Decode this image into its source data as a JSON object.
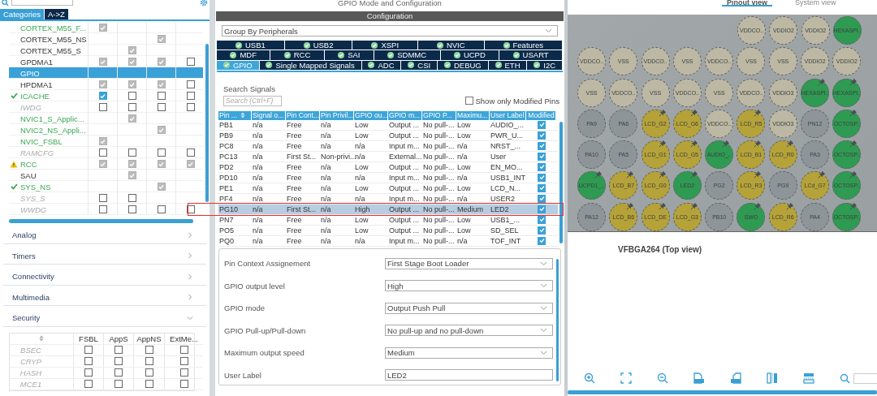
{
  "left": {
    "tabs": [
      {
        "label": "Categories",
        "selected": true
      },
      {
        "label": "A->Z",
        "selected": false
      }
    ],
    "rows": [
      {
        "name": "CORTEX_M55_F...",
        "kind": "configured",
        "ok": false,
        "warning": false,
        "selected": false,
        "cells": [
          {
            "kind": "box",
            "checked": true,
            "disabled": true
          },
          {
            "kind": "blank"
          },
          {
            "kind": "blank"
          },
          {
            "kind": "blank"
          }
        ]
      },
      {
        "name": "CORTEX_M55_NS",
        "kind": "plain",
        "ok": false,
        "warning": false,
        "selected": false,
        "cells": [
          {
            "kind": "blank"
          },
          {
            "kind": "blank"
          },
          {
            "kind": "box",
            "checked": true,
            "disabled": true
          },
          {
            "kind": "blank"
          }
        ]
      },
      {
        "name": "CORTEX_M55_S",
        "kind": "plain",
        "ok": false,
        "warning": false,
        "selected": false,
        "cells": [
          {
            "kind": "blank"
          },
          {
            "kind": "box",
            "checked": true,
            "disabled": true
          },
          {
            "kind": "blank"
          },
          {
            "kind": "blank"
          }
        ]
      },
      {
        "name": "GPDMA1",
        "kind": "plain",
        "ok": false,
        "warning": false,
        "selected": false,
        "cells": [
          {
            "kind": "box",
            "checked": true,
            "disabled": true
          },
          {
            "kind": "box",
            "checked": true,
            "disabled": true
          },
          {
            "kind": "box",
            "checked": true,
            "disabled": true
          },
          {
            "kind": "box",
            "checked": false
          }
        ]
      },
      {
        "name": "GPIO",
        "kind": "plain",
        "ok": false,
        "warning": false,
        "selected": true,
        "cells": [
          {
            "kind": "blank"
          },
          {
            "kind": "blank"
          },
          {
            "kind": "blank"
          },
          {
            "kind": "blank"
          }
        ]
      },
      {
        "name": "HPDMA1",
        "kind": "plain",
        "ok": false,
        "warning": false,
        "selected": false,
        "cells": [
          {
            "kind": "box",
            "checked": true,
            "disabled": true
          },
          {
            "kind": "box",
            "checked": true,
            "disabled": true
          },
          {
            "kind": "box",
            "checked": true,
            "disabled": true
          },
          {
            "kind": "box",
            "checked": false
          }
        ]
      },
      {
        "name": "ICACHE",
        "kind": "configured",
        "ok": true,
        "warning": false,
        "selected": false,
        "cells": [
          {
            "kind": "box",
            "checked": true,
            "disabled": false
          },
          {
            "kind": "box",
            "checked": false
          },
          {
            "kind": "box",
            "checked": false
          },
          {
            "kind": "box",
            "checked": false
          }
        ]
      },
      {
        "name": "IWDG",
        "kind": "unavailable",
        "ok": false,
        "warning": false,
        "selected": false,
        "cells": [
          {
            "kind": "box",
            "checked": false
          },
          {
            "kind": "box",
            "checked": false
          },
          {
            "kind": "box",
            "checked": false
          },
          {
            "kind": "box",
            "checked": false
          }
        ]
      },
      {
        "name": "NVIC1_S_Applic...",
        "kind": "configured",
        "ok": false,
        "warning": false,
        "selected": false,
        "cells": [
          {
            "kind": "blank"
          },
          {
            "kind": "box",
            "checked": true,
            "disabled": true
          },
          {
            "kind": "blank"
          },
          {
            "kind": "blank"
          }
        ]
      },
      {
        "name": "NVIC2_NS_Appli...",
        "kind": "configured",
        "ok": false,
        "warning": false,
        "selected": false,
        "cells": [
          {
            "kind": "blank"
          },
          {
            "kind": "blank"
          },
          {
            "kind": "box",
            "checked": true,
            "disabled": true
          },
          {
            "kind": "blank"
          }
        ]
      },
      {
        "name": "NVIC_FSBL",
        "kind": "configured",
        "ok": false,
        "warning": false,
        "selected": false,
        "cells": [
          {
            "kind": "box",
            "checked": true,
            "disabled": true
          },
          {
            "kind": "blank"
          },
          {
            "kind": "blank"
          },
          {
            "kind": "blank"
          }
        ]
      },
      {
        "name": "RAMCFG",
        "kind": "unavailable",
        "ok": false,
        "warning": false,
        "selected": false,
        "cells": [
          {
            "kind": "box",
            "checked": false
          },
          {
            "kind": "box",
            "checked": false
          },
          {
            "kind": "box",
            "checked": false
          },
          {
            "kind": "box",
            "checked": false
          }
        ]
      },
      {
        "name": "RCC",
        "kind": "configured",
        "ok": false,
        "warning": true,
        "selected": false,
        "cells": [
          {
            "kind": "box",
            "checked": true,
            "disabled": true
          },
          {
            "kind": "box",
            "checked": true,
            "disabled": true
          },
          {
            "kind": "box",
            "checked": true,
            "disabled": true
          },
          {
            "kind": "box",
            "checked": true,
            "disabled": true
          }
        ]
      },
      {
        "name": "SAU",
        "kind": "plain",
        "ok": false,
        "warning": false,
        "selected": false,
        "cells": [
          {
            "kind": "blank"
          },
          {
            "kind": "box",
            "checked": true,
            "disabled": true
          },
          {
            "kind": "blank"
          },
          {
            "kind": "blank"
          }
        ]
      },
      {
        "name": "SYS_NS",
        "kind": "configured",
        "ok": true,
        "warning": false,
        "selected": false,
        "cells": [
          {
            "kind": "blank"
          },
          {
            "kind": "blank"
          },
          {
            "kind": "box",
            "checked": true,
            "disabled": true
          },
          {
            "kind": "blank"
          }
        ]
      },
      {
        "name": "SYS_S",
        "kind": "unavailable",
        "ok": false,
        "warning": false,
        "selected": false,
        "cells": [
          {
            "kind": "box",
            "checked": false
          },
          {
            "kind": "box",
            "checked": false
          },
          {
            "kind": "blank"
          },
          {
            "kind": "blank"
          }
        ]
      },
      {
        "name": "WWDG",
        "kind": "unavailable",
        "ok": false,
        "warning": false,
        "selected": false,
        "cells": [
          {
            "kind": "box",
            "checked": false
          },
          {
            "kind": "box",
            "checked": false
          },
          {
            "kind": "box",
            "checked": false
          },
          {
            "kind": "box",
            "checked": false
          }
        ]
      }
    ],
    "categories": [
      {
        "label": "Analog",
        "expanded": false
      },
      {
        "label": "Timers",
        "expanded": false
      },
      {
        "label": "Connectivity",
        "expanded": false
      },
      {
        "label": "Multimedia",
        "expanded": false
      },
      {
        "label": "Security",
        "expanded": true
      }
    ],
    "security": {
      "columns": [
        "FSBL",
        "AppS",
        "AppNS",
        "ExtMe..."
      ],
      "rows": [
        {
          "name": "BSEC",
          "cells": [
            {
              "checked": false
            },
            {
              "checked": false
            },
            {
              "checked": false
            },
            {
              "checked": false
            }
          ]
        },
        {
          "name": "CRYP",
          "cells": [
            {
              "checked": false
            },
            {
              "checked": false
            },
            {
              "checked": false
            },
            {
              "checked": false
            }
          ]
        },
        {
          "name": "HASH",
          "cells": [
            {
              "checked": false
            },
            {
              "checked": false
            },
            {
              "checked": false
            },
            {
              "checked": false
            }
          ]
        },
        {
          "name": "MCE1",
          "cells": [
            {
              "checked": false
            },
            {
              "checked": false
            },
            {
              "checked": false
            },
            {
              "checked": false
            }
          ]
        }
      ]
    }
  },
  "middle": {
    "title": "GPIO Mode and Configuration",
    "section": "Configuration",
    "group_by": "Group By Peripherals",
    "tab_rows": [
      [
        {
          "label": "USB1",
          "selected": false
        },
        {
          "label": "USB2",
          "selected": false
        },
        {
          "label": "XSPI",
          "selected": false
        },
        {
          "label": "NVIC",
          "selected": false
        },
        {
          "label": "Features",
          "selected": false
        }
      ],
      [
        {
          "label": "MDF",
          "selected": false
        },
        {
          "label": "RCC",
          "selected": false
        },
        {
          "label": "SAI",
          "selected": false
        },
        {
          "label": "SDMMC",
          "selected": false
        },
        {
          "label": "UCPD",
          "selected": false
        },
        {
          "label": "USART",
          "selected": false
        }
      ],
      [
        {
          "label": "GPIO",
          "selected": true
        },
        {
          "label": "Single Mapped Signals",
          "selected": false
        },
        {
          "label": "ADC",
          "selected": false
        },
        {
          "label": "CSI",
          "selected": false
        },
        {
          "label": "DEBUG",
          "selected": false
        },
        {
          "label": "ETH",
          "selected": false
        },
        {
          "label": "I2C",
          "selected": false
        }
      ]
    ],
    "search_label": "Search Signals",
    "search": {
      "placeholder": "Search (Ctrl+F)"
    },
    "modified_only": {
      "label": "Show only Modified Pins",
      "checked": false
    },
    "table": {
      "columns": [
        "Pin ...",
        "Signal o...",
        "Pin Cont...",
        "Pin Privil...",
        "GPIO ou...",
        "GPIO m...",
        "GPIO P...",
        "Maximu...",
        "User Label",
        "Modified"
      ],
      "rows": [
        {
          "cells": [
            "PB1",
            "n/a",
            "Free",
            "n/a",
            "Low",
            "Output ...",
            "No pull-...",
            "Low",
            "AUDIO_..."
          ],
          "modified": true,
          "selected": false,
          "highlighted": false
        },
        {
          "cells": [
            "PB9",
            "n/a",
            "Free",
            "n/a",
            "Low",
            "Output ...",
            "No pull-...",
            "Low",
            "PWR_U..."
          ],
          "modified": true,
          "selected": false,
          "highlighted": false
        },
        {
          "cells": [
            "PC8",
            "n/a",
            "Free",
            "n/a",
            "n/a",
            "Input m...",
            "No pull-...",
            "n/a",
            "NRST_..."
          ],
          "modified": true,
          "selected": false,
          "highlighted": false
        },
        {
          "cells": [
            "PC13",
            "n/a",
            "First St...",
            "Non-privi...",
            "n/a",
            "External...",
            "No pull-...",
            "n/a",
            "User"
          ],
          "modified": true,
          "selected": false,
          "highlighted": false
        },
        {
          "cells": [
            "PD2",
            "n/a",
            "Free",
            "n/a",
            "Low",
            "Output ...",
            "No pull-...",
            "Low",
            "EN_MO..."
          ],
          "modified": true,
          "selected": false,
          "highlighted": false
        },
        {
          "cells": [
            "PD10",
            "n/a",
            "Free",
            "n/a",
            "n/a",
            "Input m...",
            "No pull-...",
            "n/a",
            "USB1_INT"
          ],
          "modified": true,
          "selected": false,
          "highlighted": false
        },
        {
          "cells": [
            "PE1",
            "n/a",
            "Free",
            "n/a",
            "Low",
            "Output ...",
            "No pull-...",
            "Low",
            "LCD_N..."
          ],
          "modified": true,
          "selected": false,
          "highlighted": false
        },
        {
          "cells": [
            "PF4",
            "n/a",
            "Free",
            "n/a",
            "n/a",
            "Input m...",
            "No pull-...",
            "n/a",
            "USER2"
          ],
          "modified": true,
          "selected": false,
          "highlighted": false
        },
        {
          "cells": [
            "PG10",
            "n/a",
            "First St...",
            "n/a",
            "High",
            "Output ...",
            "No pull-...",
            "Medium",
            "LED2"
          ],
          "modified": true,
          "selected": true,
          "highlighted": true
        },
        {
          "cells": [
            "PN7",
            "n/a",
            "Free",
            "n/a",
            "Low",
            "Output ...",
            "No pull-...",
            "Low",
            "USB1_..."
          ],
          "modified": true,
          "selected": false,
          "highlighted": false
        },
        {
          "cells": [
            "PO5",
            "n/a",
            "Free",
            "n/a",
            "Low",
            "Output ...",
            "No pull-...",
            "Low",
            "SD_SEL"
          ],
          "modified": true,
          "selected": false,
          "highlighted": false
        },
        {
          "cells": [
            "PQ0",
            "n/a",
            "Free",
            "n/a",
            "n/a",
            "Input m...",
            "No pull-...",
            "n/a",
            "TOF_INT"
          ],
          "modified": true,
          "selected": false,
          "highlighted": false
        }
      ]
    },
    "details": [
      {
        "label": "Pin Context Assignement",
        "kind": "select",
        "value": "First Stage Boot Loader"
      },
      {
        "label": "GPIO output level",
        "kind": "select",
        "value": "High"
      },
      {
        "label": "GPIO mode",
        "kind": "select",
        "value": "Output Push Pull"
      },
      {
        "label": "GPIO Pull-up/Pull-down",
        "kind": "select",
        "value": "No pull-up and no pull-down"
      },
      {
        "label": "Maximum output speed",
        "kind": "select",
        "value": "Medium"
      },
      {
        "label": "User Label",
        "kind": "text",
        "value": "LED2"
      }
    ]
  },
  "right": {
    "tabs": [
      {
        "label": "Pinout view",
        "selected": true
      },
      {
        "label": "System view",
        "selected": false
      }
    ],
    "pins": [
      [
        {
          "label": "VDDCO..",
          "color": "#bdb8a3",
          "pinned": false
        },
        {
          "label": "VDDIO2",
          "color": "#bdb8a3",
          "pinned": false
        },
        {
          "label": "VDDIO2",
          "color": "#bdb8a3",
          "pinned": false
        },
        {
          "label": "HEXASPI..",
          "color": "#2f9a52",
          "pinned": false
        }
      ],
      [
        {
          "label": "VDDCO..",
          "color": "#bdb8a3",
          "pinned": false
        },
        {
          "label": "VSS",
          "color": "#bdb8a3",
          "pinned": false
        },
        {
          "label": "VDDCO..",
          "color": "#bdb8a3",
          "pinned": false
        },
        {
          "label": "VSS",
          "color": "#bdb8a3",
          "pinned": false
        },
        {
          "label": "VDDCO..",
          "color": "#bdb8a3",
          "pinned": false
        },
        {
          "label": "VSS",
          "color": "#bdb8a3",
          "pinned": false
        },
        {
          "label": "VSS",
          "color": "#bdb8a3",
          "pinned": false
        },
        {
          "label": "VDDIO2",
          "color": "#bdb8a3",
          "pinned": false
        },
        {
          "label": "VDDIO2",
          "color": "#bdb8a3",
          "pinned": false
        }
      ],
      [
        {
          "label": "VSS",
          "color": "#bdb8a3",
          "pinned": false
        },
        {
          "label": "VDDCO..",
          "color": "#bdb8a3",
          "pinned": false
        },
        {
          "label": "VSS",
          "color": "#bdb8a3",
          "pinned": false
        },
        {
          "label": "VDDCO..",
          "color": "#bdb8a3",
          "pinned": false
        },
        {
          "label": "VSS",
          "color": "#bdb8a3",
          "pinned": false
        },
        {
          "label": "VDDCO..",
          "color": "#bdb8a3",
          "pinned": false
        },
        {
          "label": "VDDIO3",
          "color": "#bdb8a3",
          "pinned": false
        },
        {
          "label": "HEXASPI..",
          "color": "#2f9a52",
          "pinned": true
        },
        {
          "label": "HEXASPI..",
          "color": "#2f9a52",
          "pinned": true
        }
      ],
      [
        {
          "label": "PA9",
          "color": "#8e9599",
          "pinned": false
        },
        {
          "label": "PA6",
          "color": "#8e9599",
          "pinned": false
        },
        {
          "label": "LCD_G2",
          "color": "#b5a238",
          "pinned": true
        },
        {
          "label": "LCD_G6",
          "color": "#b5a238",
          "pinned": true
        },
        {
          "label": "VDDCO..",
          "color": "#bdb8a3",
          "pinned": false
        },
        {
          "label": "LCD_R5",
          "color": "#b5a238",
          "pinned": true
        },
        {
          "label": "VDDIO3",
          "color": "#bdb8a3",
          "pinned": false
        },
        {
          "label": "PN12",
          "color": "#8e9599",
          "pinned": false
        },
        {
          "label": "OCTOSP..",
          "color": "#2f9a52",
          "pinned": true
        }
      ],
      [
        {
          "label": "PA10",
          "color": "#8e9599",
          "pinned": false
        },
        {
          "label": "PA5",
          "color": "#8e9599",
          "pinned": false
        },
        {
          "label": "LCD_G1",
          "color": "#b5a238",
          "pinned": true
        },
        {
          "label": "LCD_G5",
          "color": "#b5a238",
          "pinned": true
        },
        {
          "label": "AUDIO_..",
          "color": "#2f9a52",
          "pinned": true
        },
        {
          "label": "LCD_B1",
          "color": "#b5a238",
          "pinned": true
        },
        {
          "label": "LCD_R0",
          "color": "#b5a238",
          "pinned": true
        },
        {
          "label": "PA3",
          "color": "#8e9599",
          "pinned": false
        },
        {
          "label": "OCTOSP..",
          "color": "#2f9a52",
          "pinned": true
        }
      ],
      [
        {
          "label": "UCPD1_..",
          "color": "#2f9a52",
          "pinned": true
        },
        {
          "label": "LCD_B7",
          "color": "#b5a238",
          "pinned": true
        },
        {
          "label": "LCD_G0",
          "color": "#b5a238",
          "pinned": true
        },
        {
          "label": "LED2",
          "color": "#2f9a52",
          "pinned": true
        },
        {
          "label": "PG2",
          "color": "#8e9599",
          "pinned": false
        },
        {
          "label": "LCD_R3",
          "color": "#b5a238",
          "pinned": true
        },
        {
          "label": "PG9",
          "color": "#8e9599",
          "pinned": false
        },
        {
          "label": "LCd_G7",
          "color": "#b5a238",
          "pinned": true
        },
        {
          "label": "OCTOSP..",
          "color": "#2f9a52",
          "pinned": true
        }
      ],
      [
        {
          "label": "PA12",
          "color": "#8e9599",
          "pinned": false
        },
        {
          "label": "LCD_B6",
          "color": "#b5a238",
          "pinned": true
        },
        {
          "label": "LCD_DE",
          "color": "#b5a238",
          "pinned": true
        },
        {
          "label": "LCD_G3",
          "color": "#b5a238",
          "pinned": true
        },
        {
          "label": "PB10",
          "color": "#8e9599",
          "pinned": false
        },
        {
          "label": "SWO",
          "color": "#2f9a52",
          "pinned": true
        },
        {
          "label": "LCD_R6",
          "color": "#b5a238",
          "pinned": true
        },
        {
          "label": "PA4",
          "color": "#8e9599",
          "pinned": false
        },
        {
          "label": "OCTOSP..",
          "color": "#2f9a52",
          "pinned": true
        }
      ]
    ],
    "caption": "VFBGA264 (Top view)"
  }
}
